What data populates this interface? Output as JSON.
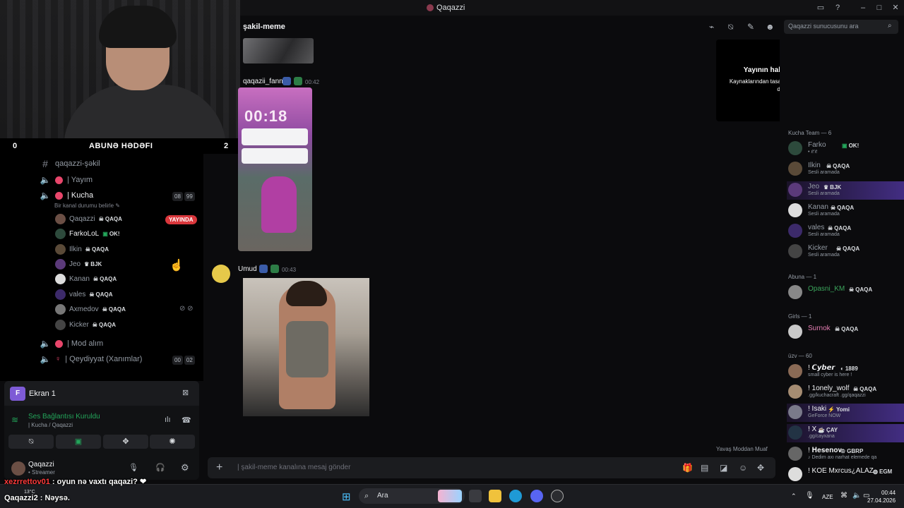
{
  "window": {
    "title": "Qaqazzi"
  },
  "goal": {
    "left_count": "0",
    "right_count": "2",
    "title": "ABUNƏ HƏDƏFI"
  },
  "channels": {
    "thumbnail": "thumbnail",
    "qaqazzi_sekil": "qaqazzi-şəkil",
    "yayim": "| Yayım",
    "kucha": "| Kucha",
    "kucha_status": "Bir kanal durumu belirle ✎",
    "kucha_count_a": "08",
    "kucha_count_b": "99",
    "mod_alim": "| Mod alım",
    "qeydiyyat": "| Qeydiyyat (Xanımlar)",
    "qeydiyyat_count_a": "00",
    "qeydiyyat_count_b": "02"
  },
  "voice_users": [
    {
      "name": "Qaqazzi",
      "tag": "QAQA",
      "live": "YAYINDA"
    },
    {
      "name": "FarkoLoL",
      "tag": "OK!"
    },
    {
      "name": "Ilkin",
      "tag": "QAQA"
    },
    {
      "name": "Jeo",
      "tag": "BJK"
    },
    {
      "name": "Kanan",
      "tag": "QAQA"
    },
    {
      "name": "vales",
      "tag": "QAQA"
    },
    {
      "name": "Axmedov",
      "tag": "QAQA"
    },
    {
      "name": "Kicker",
      "tag": "QAQA"
    }
  ],
  "panel": {
    "stream_label": "Ekran 1",
    "stream_initial": "F",
    "voice_status": "Ses Bağlantısı Kuruldu",
    "voice_sub": "| Kucha / Qaqazzi",
    "user_name": "Qaqazzi",
    "user_sub": "• Streamer"
  },
  "chat": {
    "channel_name": "şakil-meme",
    "search_placeholder": "Qaqazzi sunucusunu ara",
    "msg1_author": "qaqazii_fann",
    "msg1_time": "00:42",
    "phone_time": "00:18",
    "msg2_author": "Umud",
    "msg2_time": "00:43",
    "slowmode": "Yavaş Moddan Muaf",
    "composer_placeholder": "| şakil-meme kanalına mesaj gönder"
  },
  "popup": {
    "title": "Yayının halen devam ediyor!",
    "body": "Kaynaklarından tasarruf etmek için bu önizlemeyi duraklattık."
  },
  "members": {
    "groups": {
      "kucha_team": "Kucha Team — 6",
      "abuna": "Abuna — 1",
      "girls": "Girls — 1",
      "uzv": "üzv — 60"
    },
    "list": [
      {
        "name": "Farko",
        "tag": "OK!",
        "sub": "• ደ'ደ"
      },
      {
        "name": "Ilkin",
        "tag": "QAQA",
        "sub": "Sesli aramada"
      },
      {
        "name": "Jeo",
        "tag": "BJK",
        "sub": "Sesli aramada"
      },
      {
        "name": "Kanan",
        "tag": "QAQA",
        "sub": "Sesli aramada"
      },
      {
        "name": "vales",
        "tag": "QAQA",
        "sub": "Sesli aramada"
      },
      {
        "name": "Kicker",
        "tag": "QAQA",
        "sub": "Sesli aramada"
      },
      {
        "name": "Opasni_KM",
        "tag": "QAQA",
        "sub": ""
      },
      {
        "name": "Surnok",
        "tag": "QAQA",
        "sub": ""
      },
      {
        "name": "! 𝘾𝙮𝙗𝙚𝙧",
        "tag": "1889",
        "sub": "small cyber is here !"
      },
      {
        "name": "! 1onely_wolf",
        "tag": "QAQA",
        "sub": ".gg/kuchacraft .gg/qaqazzi"
      },
      {
        "name": "! Isaki",
        "tag": "Yomi",
        "sub": "GeForce NOW"
      },
      {
        "name": "! X",
        "tag": "ÇAY",
        "sub": ".gg/cayxana"
      },
      {
        "name": "! 𝐇𝐞𝐬𝐞𝐧𝐨𝐯",
        "tag": "GBRP",
        "sub": "♪ Dedim axı narhat elemede qa"
      },
      {
        "name": "! KOE Mxrcus¿ALAZ",
        "tag": "EGM",
        "sub": ""
      }
    ]
  },
  "overlay": {
    "line1_user": "xezrrettov01",
    "line1_text": " : oyun nə vaxtı qaqazi? ❤",
    "line2_user": "Qaqazzi2",
    "line2_text": " : Nəysə."
  },
  "taskbar": {
    "search": "Ara",
    "weather": "13°C",
    "lang": "AZE",
    "time": "00:44",
    "date": "27.04.2026"
  },
  "colors": {
    "accent": "#5865f2",
    "live": "#da373c",
    "online": "#23a55a",
    "pink": "#e8466b"
  }
}
